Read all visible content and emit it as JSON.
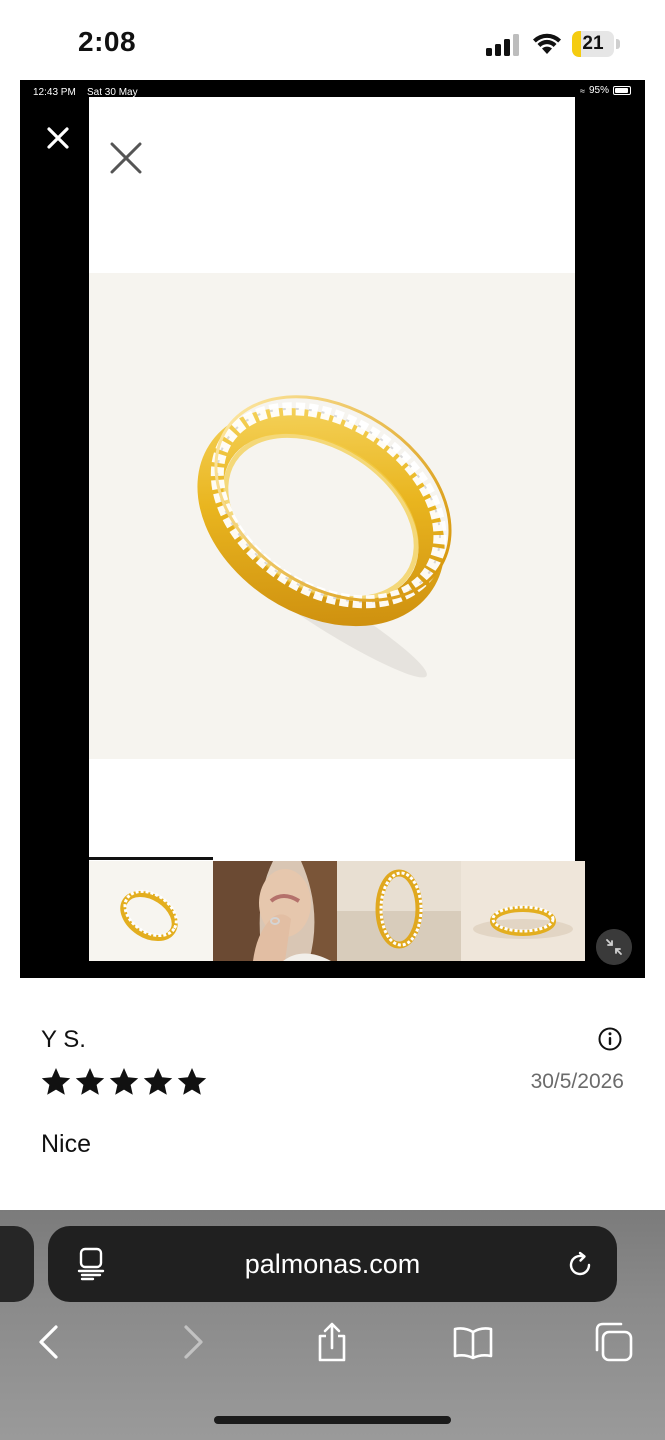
{
  "status_bar": {
    "time": "2:08",
    "battery_level": "21",
    "battery_fraction": 0.21,
    "icons": [
      "signal-icon",
      "wifi-icon",
      "battery-icon"
    ]
  },
  "embedded_screenshot": {
    "status": {
      "time": "12:43 PM",
      "date": "Sat 30 May",
      "battery": "95%"
    },
    "gallery": {
      "active_thumbnail": 1,
      "thumbnail_count": 4,
      "icons": [
        "close-icon",
        "close-icon",
        "shrink-icon"
      ]
    }
  },
  "review": {
    "reviewer": "Y S.",
    "rating": 5,
    "rating_max": 5,
    "date": "30/5/2026",
    "text": "Nice",
    "icons": [
      "info-icon",
      "star-icon"
    ]
  },
  "safari": {
    "url": "palmonas.com",
    "icons": [
      "reader-icon",
      "reload-icon",
      "back-icon",
      "forward-icon",
      "share-icon",
      "bookmarks-icon",
      "tabs-icon"
    ]
  },
  "colors": {
    "accent_battery": "#f5cc10",
    "star": "#111111",
    "toolbar_bg": "#202020"
  }
}
